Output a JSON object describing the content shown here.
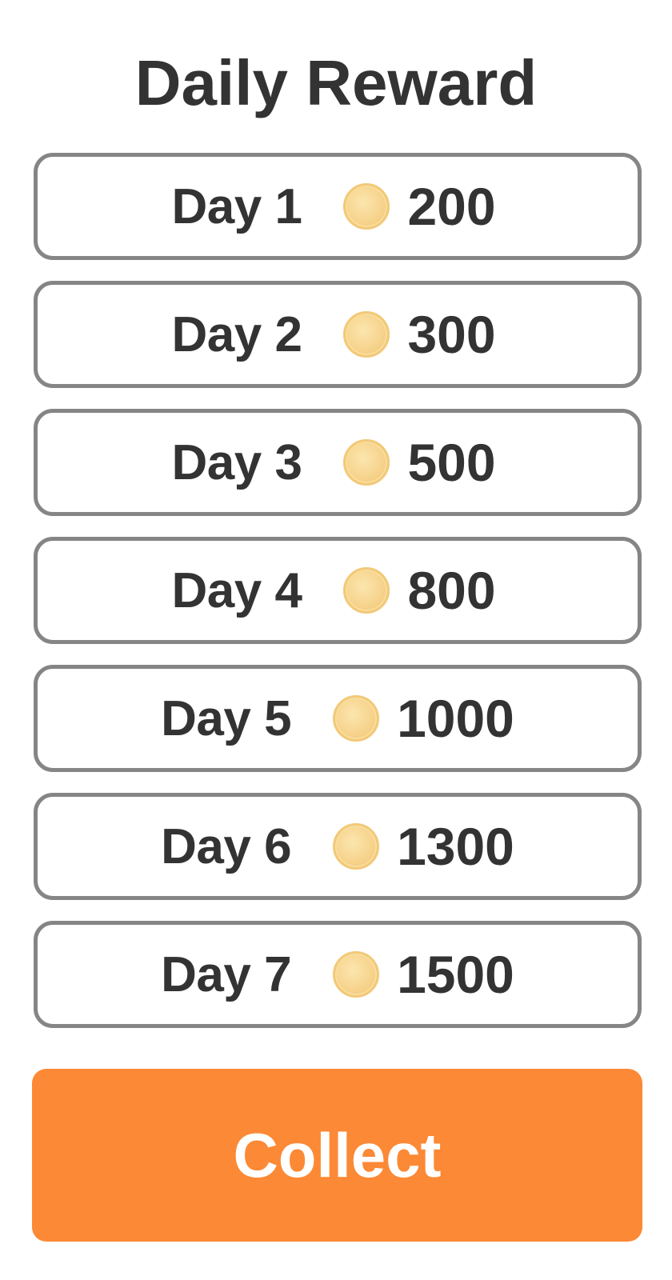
{
  "title": "Daily Reward",
  "rewards": [
    {
      "day": "Day 1",
      "amount": "200"
    },
    {
      "day": "Day 2",
      "amount": "300"
    },
    {
      "day": "Day 3",
      "amount": "500"
    },
    {
      "day": "Day 4",
      "amount": "800"
    },
    {
      "day": "Day 5",
      "amount": "1000"
    },
    {
      "day": "Day 6",
      "amount": "1300"
    },
    {
      "day": "Day 7",
      "amount": "1500"
    }
  ],
  "reward_icon": "gold-coin-icon",
  "collect_label": "Collect",
  "colors": {
    "text": "#333333",
    "row_border": "#858585",
    "coin": "#f7d48e",
    "collect_button": "#fc8935",
    "collect_text": "#ffffff"
  }
}
